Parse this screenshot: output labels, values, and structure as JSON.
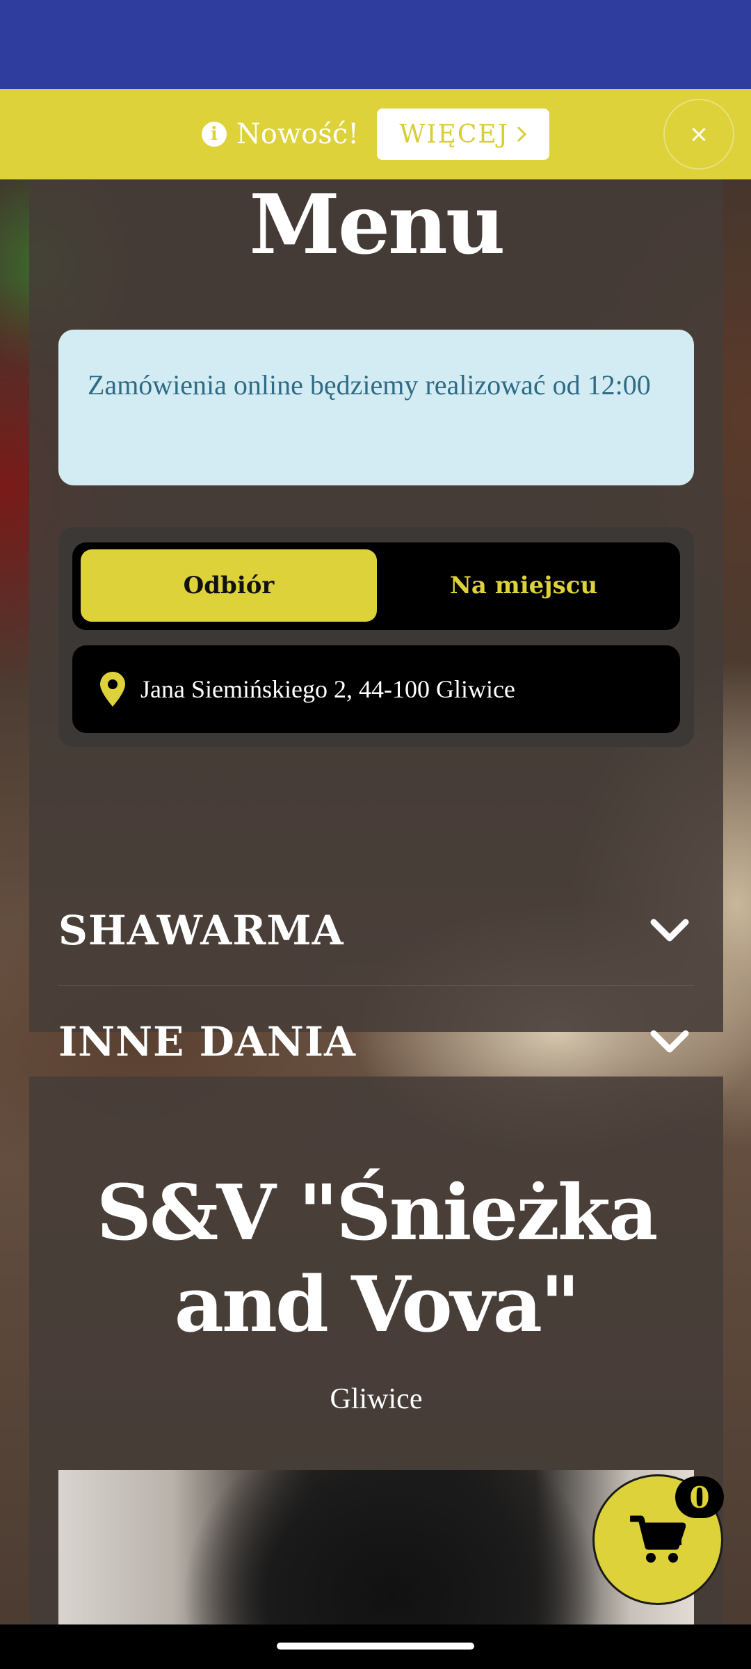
{
  "notice": {
    "info_icon": "info-circle-icon",
    "text": "Nowość!",
    "more_button": "WIĘCEJ",
    "more_icon": "chevron-right-icon",
    "close_icon": "close-icon",
    "close_glyph": "×"
  },
  "menu": {
    "title": "Menu",
    "alert_text": "Zamówienia online będziemy realizować od 12:00",
    "order_types": [
      {
        "label": "Odbiór",
        "selected": true
      },
      {
        "label": "Na miejscu",
        "selected": false
      }
    ],
    "address": "Jana Siemińskiego 2, 44-100 Gliwice",
    "categories": [
      {
        "label": "SHAWARMA"
      },
      {
        "label": "INNE DANIA"
      }
    ]
  },
  "restaurant": {
    "name": "S&V \"Śnieżka and Vova\"",
    "city": "Gliwice"
  },
  "cart": {
    "count": "0",
    "icon": "cart-icon"
  },
  "colors": {
    "status_bar": "#2f3e9e",
    "accent_yellow": "#ddd23a",
    "alert_bg": "#d3ecf4",
    "alert_text": "#2f6b84"
  }
}
